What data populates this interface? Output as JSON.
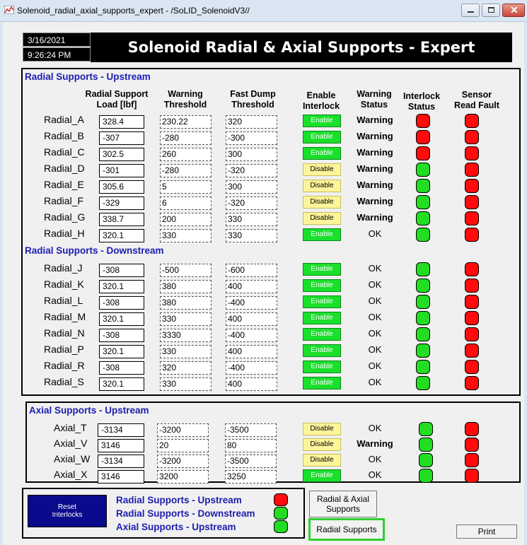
{
  "window": {
    "title": "Solenoid_radial_axial_supports_expert - /SoLID_SolenoidV3//"
  },
  "header": {
    "date": "3/16/2021",
    "time": "9:26:24 PM",
    "title": "Solenoid Radial & Axial Supports - Expert"
  },
  "columns": {
    "radial_load": "Radial Support\nLoad [lbf]",
    "warning_threshold": "Warning\nThreshold",
    "fast_dump": "Fast Dump\nThreshold",
    "enable_interlock": "Enable\nInterlock",
    "warning_status": "Warning\nStatus",
    "interlock_status": "Interlock\nStatus",
    "sensor_fault": "Sensor\nRead Fault"
  },
  "sections": {
    "radial_up": "Radial Supports - Upstream",
    "radial_down": "Radial Supports - Downstream",
    "axial_up": "Axial Supports - Upstream"
  },
  "radial_up_rows": [
    {
      "label": "Radial_A",
      "load": "328.4",
      "warn": "230.22",
      "dump": "320",
      "btn": "Enable",
      "status": "Warning",
      "interlock": "red",
      "fault": "red"
    },
    {
      "label": "Radial_B",
      "load": "-307",
      "warn": "-280",
      "dump": "-300",
      "btn": "Enable",
      "status": "Warning",
      "interlock": "red",
      "fault": "red"
    },
    {
      "label": "Radial_C",
      "load": "302.5",
      "warn": "260",
      "dump": "300",
      "btn": "Enable",
      "status": "Warning",
      "interlock": "red",
      "fault": "red"
    },
    {
      "label": "Radial_D",
      "load": "-301",
      "warn": "-280",
      "dump": "-320",
      "btn": "Disable",
      "status": "Warning",
      "interlock": "green",
      "fault": "red"
    },
    {
      "label": "Radial_E",
      "load": "305.6",
      "warn": "5",
      "dump": "300",
      "btn": "Disable",
      "status": "Warning",
      "interlock": "green",
      "fault": "red"
    },
    {
      "label": "Radial_F",
      "load": "-329",
      "warn": "6",
      "dump": "-320",
      "btn": "Disable",
      "status": "Warning",
      "interlock": "green",
      "fault": "red"
    },
    {
      "label": "Radial_G",
      "load": "338.7",
      "warn": "200",
      "dump": "330",
      "btn": "Disable",
      "status": "Warning",
      "interlock": "green",
      "fault": "red"
    },
    {
      "label": "Radial_H",
      "load": "320.1",
      "warn": "330",
      "dump": "330",
      "btn": "Enable",
      "status": "OK",
      "interlock": "green",
      "fault": "red"
    }
  ],
  "radial_down_rows": [
    {
      "label": "Radial_J",
      "load": "-308",
      "warn": "-500",
      "dump": "-600",
      "btn": "Enable",
      "status": "OK",
      "interlock": "green",
      "fault": "red"
    },
    {
      "label": "Radial_K",
      "load": "320.1",
      "warn": "380",
      "dump": "400",
      "btn": "Enable",
      "status": "OK",
      "interlock": "green",
      "fault": "red"
    },
    {
      "label": "Radial_L",
      "load": "-308",
      "warn": "380",
      "dump": "-400",
      "btn": "Enable",
      "status": "OK",
      "interlock": "green",
      "fault": "red"
    },
    {
      "label": "Radial_M",
      "load": "320.1",
      "warn": "330",
      "dump": "400",
      "btn": "Enable",
      "status": "OK",
      "interlock": "green",
      "fault": "red"
    },
    {
      "label": "Radial_N",
      "load": "-308",
      "warn": "3330",
      "dump": "-400",
      "btn": "Enable",
      "status": "OK",
      "interlock": "green",
      "fault": "red"
    },
    {
      "label": "Radial_P",
      "load": "320.1",
      "warn": "330",
      "dump": "400",
      "btn": "Enable",
      "status": "OK",
      "interlock": "green",
      "fault": "red"
    },
    {
      "label": "Radial_R",
      "load": "-308",
      "warn": "320",
      "dump": "-400",
      "btn": "Enable",
      "status": "OK",
      "interlock": "green",
      "fault": "red"
    },
    {
      "label": "Radial_S",
      "load": "320.1",
      "warn": "330",
      "dump": "400",
      "btn": "Enable",
      "status": "OK",
      "interlock": "green",
      "fault": "red"
    }
  ],
  "axial_rows": [
    {
      "label": "Axial_T",
      "load": "-3134",
      "warn": "-3200",
      "dump": "-3500",
      "btn": "Disable",
      "status": "OK",
      "interlock": "green",
      "fault": "red"
    },
    {
      "label": "Axial_V",
      "load": "3146",
      "warn": "20",
      "dump": "80",
      "btn": "Disable",
      "status": "Warning",
      "interlock": "green",
      "fault": "red"
    },
    {
      "label": "Axial_W",
      "load": "-3134",
      "warn": "-3200",
      "dump": "-3500",
      "btn": "Disable",
      "status": "OK",
      "interlock": "green",
      "fault": "red"
    },
    {
      "label": "Axial_X",
      "load": "3146",
      "warn": "3200",
      "dump": "3250",
      "btn": "Enable",
      "status": "OK",
      "interlock": "green",
      "fault": "red"
    }
  ],
  "footer": {
    "reset_label": "Reset\nInterlocks",
    "legend": [
      {
        "label": "Radial Supports - Upstream",
        "state": "red"
      },
      {
        "label": "Radial Supports - Downstream",
        "state": "green"
      },
      {
        "label": "Axial Supports - Upstream",
        "state": "green"
      }
    ],
    "radial_axial_label": "Radial & Axial\nSupports",
    "radial_label": "Radial Supports",
    "print_label": "Print"
  },
  "colors": {
    "enable": "#19e02a",
    "disable": "#fdf59a",
    "led_red": "#ff0b0b",
    "led_green": "#22dd22",
    "section": "#1d1db0"
  }
}
